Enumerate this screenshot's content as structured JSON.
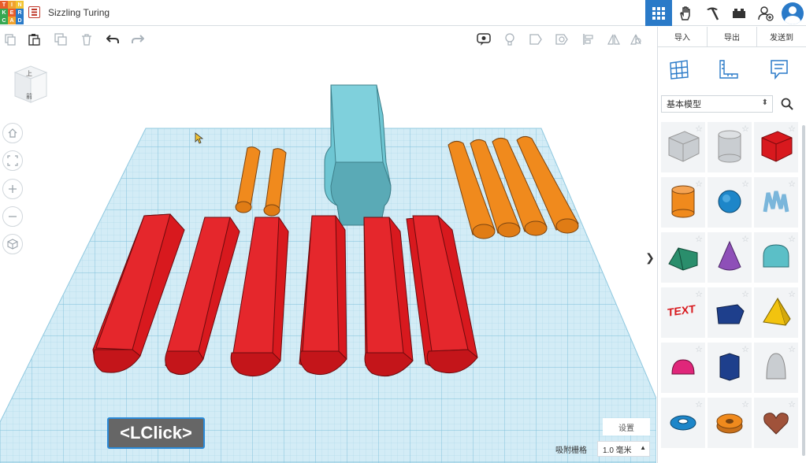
{
  "app": {
    "logo_letters": [
      "T",
      "I",
      "N",
      "K",
      "E",
      "R",
      "C",
      "A",
      "D"
    ],
    "logo_colors": [
      "#e85d2a",
      "#f0a22e",
      "#f3c431",
      "#36a852",
      "#e85d2a",
      "#2a7ac8",
      "#36a852",
      "#f0a22e",
      "#2a7ac8"
    ],
    "doc_icon": "list-icon",
    "design_title": "Sizzling Turing",
    "accent": "#2a7ac8"
  },
  "topbar_right": [
    {
      "name": "3d-view-grid",
      "icon": "grid-icon",
      "active": true
    },
    {
      "name": "circuits",
      "icon": "hand-icon",
      "active": false
    },
    {
      "name": "codeblocks",
      "icon": "pickaxe-icon",
      "active": false
    },
    {
      "name": "lego-bricks",
      "icon": "brick-icon",
      "active": false
    },
    {
      "name": "add-user",
      "icon": "add-user-icon",
      "active": false
    },
    {
      "name": "account",
      "icon": "avatar-icon",
      "active": false
    }
  ],
  "toolbar": {
    "tools": [
      "copy-icon",
      "paste-icon",
      "duplicate-icon",
      "delete-icon",
      "undo-icon",
      "redo-icon"
    ],
    "view_tools": [
      "notes-icon",
      "light-icon",
      "shape-icon",
      "hole-icon",
      "align-icon",
      "mirror-icon",
      "group-icon"
    ]
  },
  "panel": {
    "tabs": [
      "导入",
      "导出",
      "发送到"
    ],
    "view_icons": [
      "grid-panel-icon",
      "ruler-icon",
      "notes-icon"
    ],
    "library_select": "基本模型",
    "shapes": [
      {
        "name": "box-hole",
        "color": "#c9cdd1"
      },
      {
        "name": "cylinder-hole",
        "color": "#c9cdd1"
      },
      {
        "name": "box",
        "color": "#d8191e"
      },
      {
        "name": "cylinder",
        "color": "#f08a1d"
      },
      {
        "name": "sphere",
        "color": "#1d86c9"
      },
      {
        "name": "scribble",
        "color": "#7ab6db"
      },
      {
        "name": "roof",
        "color": "#2a8e6c"
      },
      {
        "name": "cone",
        "color": "#8e4fb8"
      },
      {
        "name": "round-roof",
        "color": "#5bbfc7"
      },
      {
        "name": "text",
        "color": "#d8191e"
      },
      {
        "name": "wedge",
        "color": "#1e3f8c"
      },
      {
        "name": "pyramid",
        "color": "#f2c30f"
      },
      {
        "name": "half-sphere",
        "color": "#e0267a"
      },
      {
        "name": "polygon",
        "color": "#1e3f8c"
      },
      {
        "name": "paraboloid",
        "color": "#c9cdd1"
      },
      {
        "name": "torus",
        "color": "#1d86c9"
      },
      {
        "name": "tube",
        "color": "#f08a1d"
      },
      {
        "name": "heart",
        "color": "#a0523a"
      }
    ]
  },
  "viewport": {
    "view_cube_top": "上",
    "view_cube_front": "前",
    "nav_buttons": [
      "home-icon",
      "fit-icon",
      "zoom-in-icon",
      "zoom-out-icon",
      "perspective-icon"
    ],
    "collapse_label": "❯",
    "settings_label": "设置",
    "snap_label": "吸附栅格",
    "snap_value": "1.0 毫米",
    "overlay_label": "<LClick>"
  },
  "colors": {
    "workplane": "#c5e6f2",
    "red_part": "#d8191e",
    "orange_part": "#f08a1d",
    "teal_part": "#6ec6d3"
  }
}
